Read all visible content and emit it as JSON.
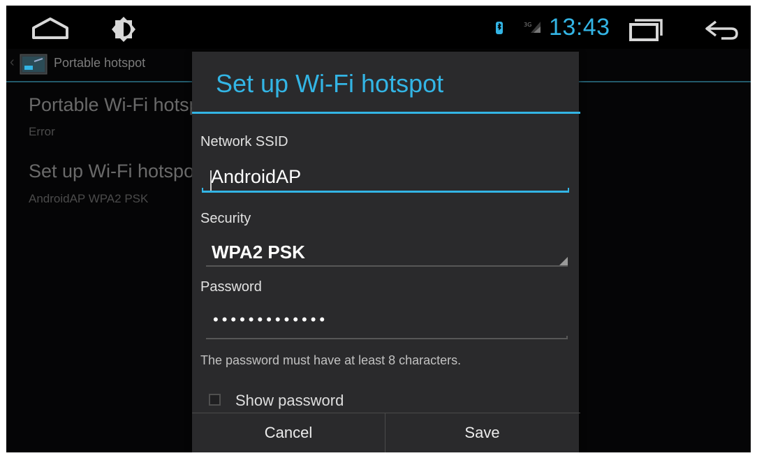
{
  "status_bar": {
    "time": "13:43",
    "icons": [
      "home-icon",
      "brightness-icon",
      "bluetooth-icon",
      "signal-icon",
      "recent-apps-icon",
      "back-icon"
    ],
    "accent_color": "#33b5e5"
  },
  "settings_page": {
    "action_bar_title": "Portable hotspot",
    "preferences": [
      {
        "title": "Portable Wi-Fi hotspot",
        "summary": "Error"
      },
      {
        "title": "Set up Wi-Fi hotspot",
        "summary": "AndroidAP WPA2 PSK"
      }
    ]
  },
  "dialog": {
    "title": "Set up Wi-Fi hotspot",
    "ssid": {
      "label": "Network SSID",
      "value": "AndroidAP"
    },
    "security": {
      "label": "Security",
      "selected": "WPA2 PSK"
    },
    "password": {
      "label": "Password",
      "masked_value": "•••••••••••••",
      "hint": "The password must have at least 8 characters."
    },
    "show_password": {
      "label": "Show password",
      "checked": false
    },
    "buttons": {
      "cancel": "Cancel",
      "save": "Save"
    }
  }
}
